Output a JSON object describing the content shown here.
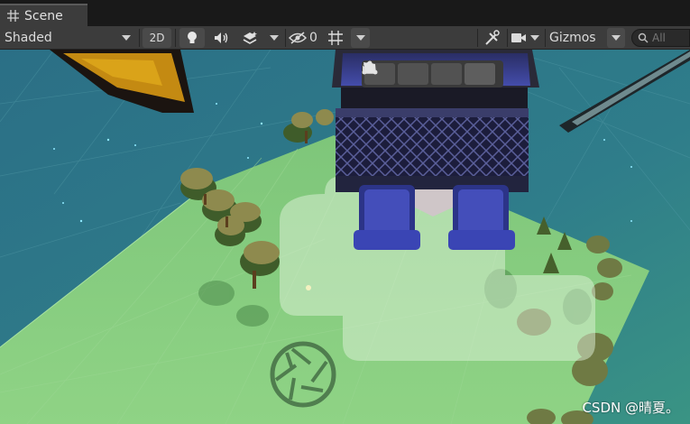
{
  "tab": {
    "label": "Scene",
    "icon": "grid-icon"
  },
  "toolbar": {
    "draw_mode": "Shaded",
    "mode_2d": "2D",
    "hidden_count": "0",
    "gizmos": "Gizmos",
    "search_placeholder": "All"
  },
  "scene_tools": [
    {
      "name": "cube-icon"
    },
    {
      "name": "nodes-icon"
    },
    {
      "name": "pen-icon"
    },
    {
      "name": "shape-icon"
    }
  ],
  "watermark": "CSDN @晴夏。"
}
